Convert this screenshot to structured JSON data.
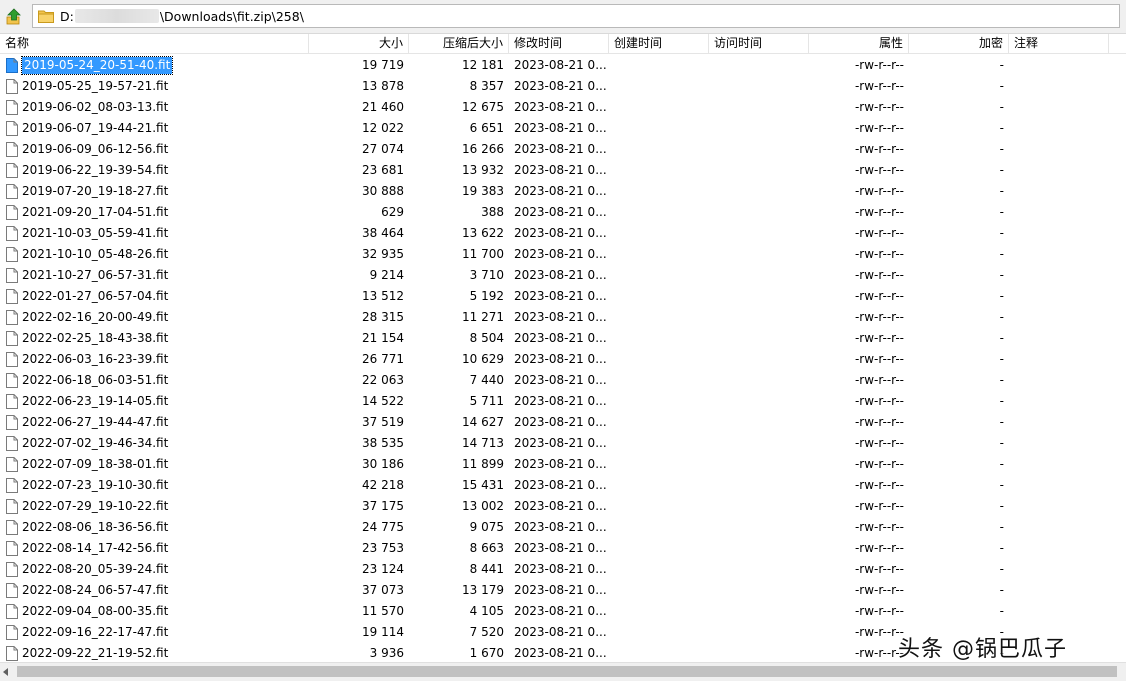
{
  "address": {
    "path_prefix": "D:",
    "path_suffix": "\\Downloads\\fit.zip\\258\\"
  },
  "columns": [
    {
      "key": "name",
      "label": "名称"
    },
    {
      "key": "size",
      "label": "大小"
    },
    {
      "key": "packed",
      "label": "压缩后大小"
    },
    {
      "key": "modified",
      "label": "修改时间"
    },
    {
      "key": "created",
      "label": "创建时间"
    },
    {
      "key": "accessed",
      "label": "访问时间"
    },
    {
      "key": "attr",
      "label": "属性"
    },
    {
      "key": "encrypted",
      "label": "加密"
    },
    {
      "key": "comment",
      "label": "注释"
    }
  ],
  "files": [
    {
      "name": "2019-05-24_20-51-40.fit",
      "size": "19 719",
      "packed": "12 181",
      "modified": "2023-08-21 0...",
      "attr": "-rw-r--r--",
      "encrypted": "-",
      "selected": true
    },
    {
      "name": "2019-05-25_19-57-21.fit",
      "size": "13 878",
      "packed": "8 357",
      "modified": "2023-08-21 0...",
      "attr": "-rw-r--r--",
      "encrypted": "-"
    },
    {
      "name": "2019-06-02_08-03-13.fit",
      "size": "21 460",
      "packed": "12 675",
      "modified": "2023-08-21 0...",
      "attr": "-rw-r--r--",
      "encrypted": "-"
    },
    {
      "name": "2019-06-07_19-44-21.fit",
      "size": "12 022",
      "packed": "6 651",
      "modified": "2023-08-21 0...",
      "attr": "-rw-r--r--",
      "encrypted": "-"
    },
    {
      "name": "2019-06-09_06-12-56.fit",
      "size": "27 074",
      "packed": "16 266",
      "modified": "2023-08-21 0...",
      "attr": "-rw-r--r--",
      "encrypted": "-"
    },
    {
      "name": "2019-06-22_19-39-54.fit",
      "size": "23 681",
      "packed": "13 932",
      "modified": "2023-08-21 0...",
      "attr": "-rw-r--r--",
      "encrypted": "-"
    },
    {
      "name": "2019-07-20_19-18-27.fit",
      "size": "30 888",
      "packed": "19 383",
      "modified": "2023-08-21 0...",
      "attr": "-rw-r--r--",
      "encrypted": "-"
    },
    {
      "name": "2021-09-20_17-04-51.fit",
      "size": "629",
      "packed": "388",
      "modified": "2023-08-21 0...",
      "attr": "-rw-r--r--",
      "encrypted": "-"
    },
    {
      "name": "2021-10-03_05-59-41.fit",
      "size": "38 464",
      "packed": "13 622",
      "modified": "2023-08-21 0...",
      "attr": "-rw-r--r--",
      "encrypted": "-"
    },
    {
      "name": "2021-10-10_05-48-26.fit",
      "size": "32 935",
      "packed": "11 700",
      "modified": "2023-08-21 0...",
      "attr": "-rw-r--r--",
      "encrypted": "-"
    },
    {
      "name": "2021-10-27_06-57-31.fit",
      "size": "9 214",
      "packed": "3 710",
      "modified": "2023-08-21 0...",
      "attr": "-rw-r--r--",
      "encrypted": "-"
    },
    {
      "name": "2022-01-27_06-57-04.fit",
      "size": "13 512",
      "packed": "5 192",
      "modified": "2023-08-21 0...",
      "attr": "-rw-r--r--",
      "encrypted": "-"
    },
    {
      "name": "2022-02-16_20-00-49.fit",
      "size": "28 315",
      "packed": "11 271",
      "modified": "2023-08-21 0...",
      "attr": "-rw-r--r--",
      "encrypted": "-"
    },
    {
      "name": "2022-02-25_18-43-38.fit",
      "size": "21 154",
      "packed": "8 504",
      "modified": "2023-08-21 0...",
      "attr": "-rw-r--r--",
      "encrypted": "-"
    },
    {
      "name": "2022-06-03_16-23-39.fit",
      "size": "26 771",
      "packed": "10 629",
      "modified": "2023-08-21 0...",
      "attr": "-rw-r--r--",
      "encrypted": "-"
    },
    {
      "name": "2022-06-18_06-03-51.fit",
      "size": "22 063",
      "packed": "7 440",
      "modified": "2023-08-21 0...",
      "attr": "-rw-r--r--",
      "encrypted": "-"
    },
    {
      "name": "2022-06-23_19-14-05.fit",
      "size": "14 522",
      "packed": "5 711",
      "modified": "2023-08-21 0...",
      "attr": "-rw-r--r--",
      "encrypted": "-"
    },
    {
      "name": "2022-06-27_19-44-47.fit",
      "size": "37 519",
      "packed": "14 627",
      "modified": "2023-08-21 0...",
      "attr": "-rw-r--r--",
      "encrypted": "-"
    },
    {
      "name": "2022-07-02_19-46-34.fit",
      "size": "38 535",
      "packed": "14 713",
      "modified": "2023-08-21 0...",
      "attr": "-rw-r--r--",
      "encrypted": "-"
    },
    {
      "name": "2022-07-09_18-38-01.fit",
      "size": "30 186",
      "packed": "11 899",
      "modified": "2023-08-21 0...",
      "attr": "-rw-r--r--",
      "encrypted": "-"
    },
    {
      "name": "2022-07-23_19-10-30.fit",
      "size": "42 218",
      "packed": "15 431",
      "modified": "2023-08-21 0...",
      "attr": "-rw-r--r--",
      "encrypted": "-"
    },
    {
      "name": "2022-07-29_19-10-22.fit",
      "size": "37 175",
      "packed": "13 002",
      "modified": "2023-08-21 0...",
      "attr": "-rw-r--r--",
      "encrypted": "-"
    },
    {
      "name": "2022-08-06_18-36-56.fit",
      "size": "24 775",
      "packed": "9 075",
      "modified": "2023-08-21 0...",
      "attr": "-rw-r--r--",
      "encrypted": "-"
    },
    {
      "name": "2022-08-14_17-42-56.fit",
      "size": "23 753",
      "packed": "8 663",
      "modified": "2023-08-21 0...",
      "attr": "-rw-r--r--",
      "encrypted": "-"
    },
    {
      "name": "2022-08-20_05-39-24.fit",
      "size": "23 124",
      "packed": "8 441",
      "modified": "2023-08-21 0...",
      "attr": "-rw-r--r--",
      "encrypted": "-"
    },
    {
      "name": "2022-08-24_06-57-47.fit",
      "size": "37 073",
      "packed": "13 179",
      "modified": "2023-08-21 0...",
      "attr": "-rw-r--r--",
      "encrypted": "-"
    },
    {
      "name": "2022-09-04_08-00-35.fit",
      "size": "11 570",
      "packed": "4 105",
      "modified": "2023-08-21 0...",
      "attr": "-rw-r--r--",
      "encrypted": "-"
    },
    {
      "name": "2022-09-16_22-17-47.fit",
      "size": "19 114",
      "packed": "7 520",
      "modified": "2023-08-21 0...",
      "attr": "-rw-r--r--",
      "encrypted": "-"
    },
    {
      "name": "2022-09-22_21-19-52.fit",
      "size": "3 936",
      "packed": "1 670",
      "modified": "2023-08-21 0...",
      "attr": "-rw-r--r--",
      "encrypted": "-"
    }
  ],
  "watermark": "头条 @锅巴瓜子",
  "icons": {
    "up": "up-folder-arrow-icon",
    "folder": "folder-icon",
    "file": "file-icon"
  },
  "colors": {
    "selection": "#3399ff",
    "arrow_green": "#2e9e2e",
    "folder_yellow": "#f2c44d"
  }
}
